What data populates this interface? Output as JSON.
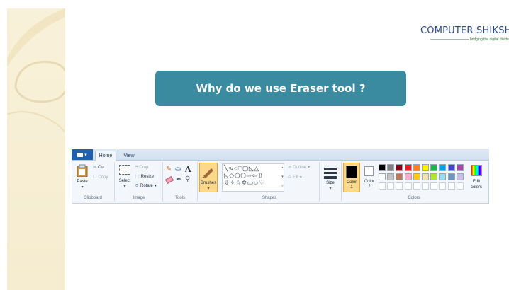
{
  "slide": {
    "title": "Why do we use Eraser tool ?",
    "brand": {
      "name_part1": "COMPUTER",
      "name_part2": " SHIKSHA",
      "tagline": "bridging the digital divide"
    }
  },
  "ribbon": {
    "file_menu_label": "▾",
    "tabs": [
      {
        "label": "Home",
        "active": true
      },
      {
        "label": "View",
        "active": false
      }
    ],
    "clipboard": {
      "paste": "Paste",
      "cut": "Cut",
      "copy": "Copy",
      "group": "Clipboard"
    },
    "image": {
      "select": "Select",
      "crop": "Crop",
      "resize": "Resize",
      "rotate": "Rotate",
      "group": "Image"
    },
    "tools": {
      "group": "Tools"
    },
    "brushes": {
      "label": "Brushes"
    },
    "shapes": {
      "outline": "Outline",
      "fill": "Fill",
      "group": "Shapes"
    },
    "size": {
      "label": "Size"
    },
    "color1": {
      "label": "Color",
      "sub": "1"
    },
    "color2": {
      "label": "Color",
      "sub": "2"
    },
    "colors": {
      "group": "Colors",
      "edit": "Edit colors",
      "row1": [
        "#000000",
        "#7f7f7f",
        "#880015",
        "#ed1c24",
        "#ff7f27",
        "#fff200",
        "#22b14c",
        "#00a2e8",
        "#3f48cc",
        "#a349a4"
      ],
      "row2": [
        "#ffffff",
        "#c3c3c3",
        "#b97a57",
        "#ffaec9",
        "#ffc90e",
        "#efe4b0",
        "#b5e61d",
        "#99d9ea",
        "#7092be",
        "#c8bfe7"
      ]
    }
  }
}
